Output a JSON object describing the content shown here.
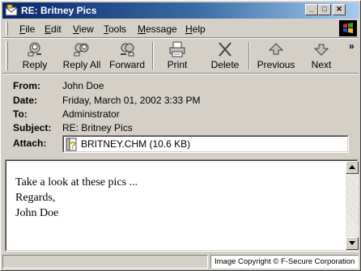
{
  "window": {
    "title": "RE: Britney Pics",
    "controls": {
      "minimize": "_",
      "maximize": "□",
      "close": "✕"
    }
  },
  "menu": {
    "items": [
      {
        "label": "File",
        "accel": "F",
        "rest": "ile"
      },
      {
        "label": "Edit",
        "accel": "E",
        "rest": "dit"
      },
      {
        "label": "View",
        "accel": "V",
        "rest": "iew"
      },
      {
        "label": "Tools",
        "accel": "T",
        "rest": "ools"
      },
      {
        "label": "Message",
        "accel": "M",
        "rest": "essage"
      },
      {
        "label": "Help",
        "accel": "H",
        "rest": "elp"
      }
    ]
  },
  "toolbar": {
    "buttons": [
      {
        "label": "Reply",
        "icon": "reply-icon"
      },
      {
        "label": "Reply All",
        "icon": "reply-all-icon"
      },
      {
        "label": "Forward",
        "icon": "forward-icon"
      },
      {
        "label": "Print",
        "icon": "print-icon"
      },
      {
        "label": "Delete",
        "icon": "delete-icon"
      },
      {
        "label": "Previous",
        "icon": "previous-icon"
      },
      {
        "label": "Next",
        "icon": "next-icon"
      }
    ],
    "overflow": "»"
  },
  "header": {
    "from_label": "From:",
    "from": "John Doe",
    "date_label": "Date:",
    "date": "Friday, March 01, 2002 3:33 PM",
    "to_label": "To:",
    "to": "Administrator",
    "subject_label": "Subject:",
    "subject": "RE: Britney Pics",
    "attach_label": "Attach:",
    "attachment": "BRITNEY.CHM (10.6 KB)"
  },
  "message": {
    "lines": [
      "Take a look at these pics ...",
      "Regards,",
      "John Doe"
    ]
  },
  "status": {
    "left": "",
    "right": "Image Copyright © F-Secure Corporation"
  },
  "colors": {
    "titlebar_start": "#0a246a",
    "titlebar_end": "#a6caf0",
    "face": "#d4d0c8"
  }
}
